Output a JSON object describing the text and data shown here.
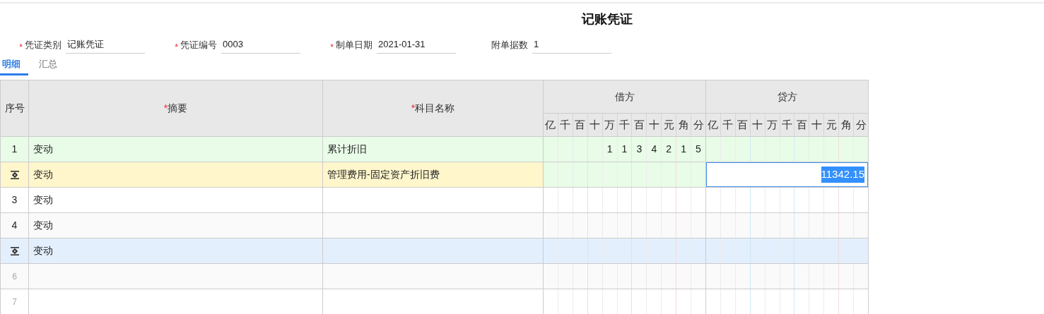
{
  "title": "记账凭证",
  "fields": [
    {
      "required_mark": "*",
      "label": "凭证类别",
      "value": "记账凭证"
    },
    {
      "required_mark": "*",
      "label": "凭证编号",
      "value": "0003"
    },
    {
      "required_mark": "*",
      "label": "制单日期",
      "value": "2021-01-31"
    },
    {
      "label": "附单据数",
      "value": "1"
    }
  ],
  "tabs": [
    {
      "label": "明细",
      "selected": true
    },
    {
      "label": "汇总",
      "selected": false
    }
  ],
  "table": {
    "columns": [
      {
        "label": "序号"
      },
      {
        "required_mark": "*",
        "label": "摘要"
      },
      {
        "required_mark": "*",
        "label": "科目名称"
      }
    ],
    "debit": {
      "label": "借方",
      "units": [
        "亿",
        "千",
        "百",
        "十",
        "万",
        "千",
        "百",
        "十",
        "元",
        "角",
        "分"
      ]
    },
    "credit": {
      "label": "贷方",
      "units": [
        "亿",
        "千",
        "百",
        "十",
        "万",
        "千",
        "百",
        "十",
        "元",
        "角",
        "分"
      ]
    },
    "rows": [
      {
        "kind": "number",
        "index": "1",
        "disabled": false,
        "color": "#e8fce8",
        "summary": "变动",
        "subject": "累计折旧",
        "debit": [
          "1",
          "1",
          "3",
          "4",
          "2",
          "1",
          "5"
        ]
      },
      {
        "kind": "icon",
        "color": "#fff6cc",
        "summary": "变动",
        "subject": "管理费用-固定资产折旧费",
        "credit_input": {
          "value": "11342.15",
          "text_selected": true
        }
      },
      {
        "kind": "number",
        "index": "3",
        "disabled": false,
        "color": "#ffffff",
        "summary": "变动"
      },
      {
        "kind": "number",
        "index": "4",
        "disabled": false,
        "color": "#fafafa",
        "summary": "变动"
      },
      {
        "kind": "icon",
        "color": "#e3effd",
        "summary": "变动"
      },
      {
        "kind": "number",
        "index": "6",
        "disabled": true,
        "color": "#fafafa"
      },
      {
        "kind": "number",
        "index": "7",
        "disabled": true,
        "color": "#ffffff"
      }
    ]
  }
}
